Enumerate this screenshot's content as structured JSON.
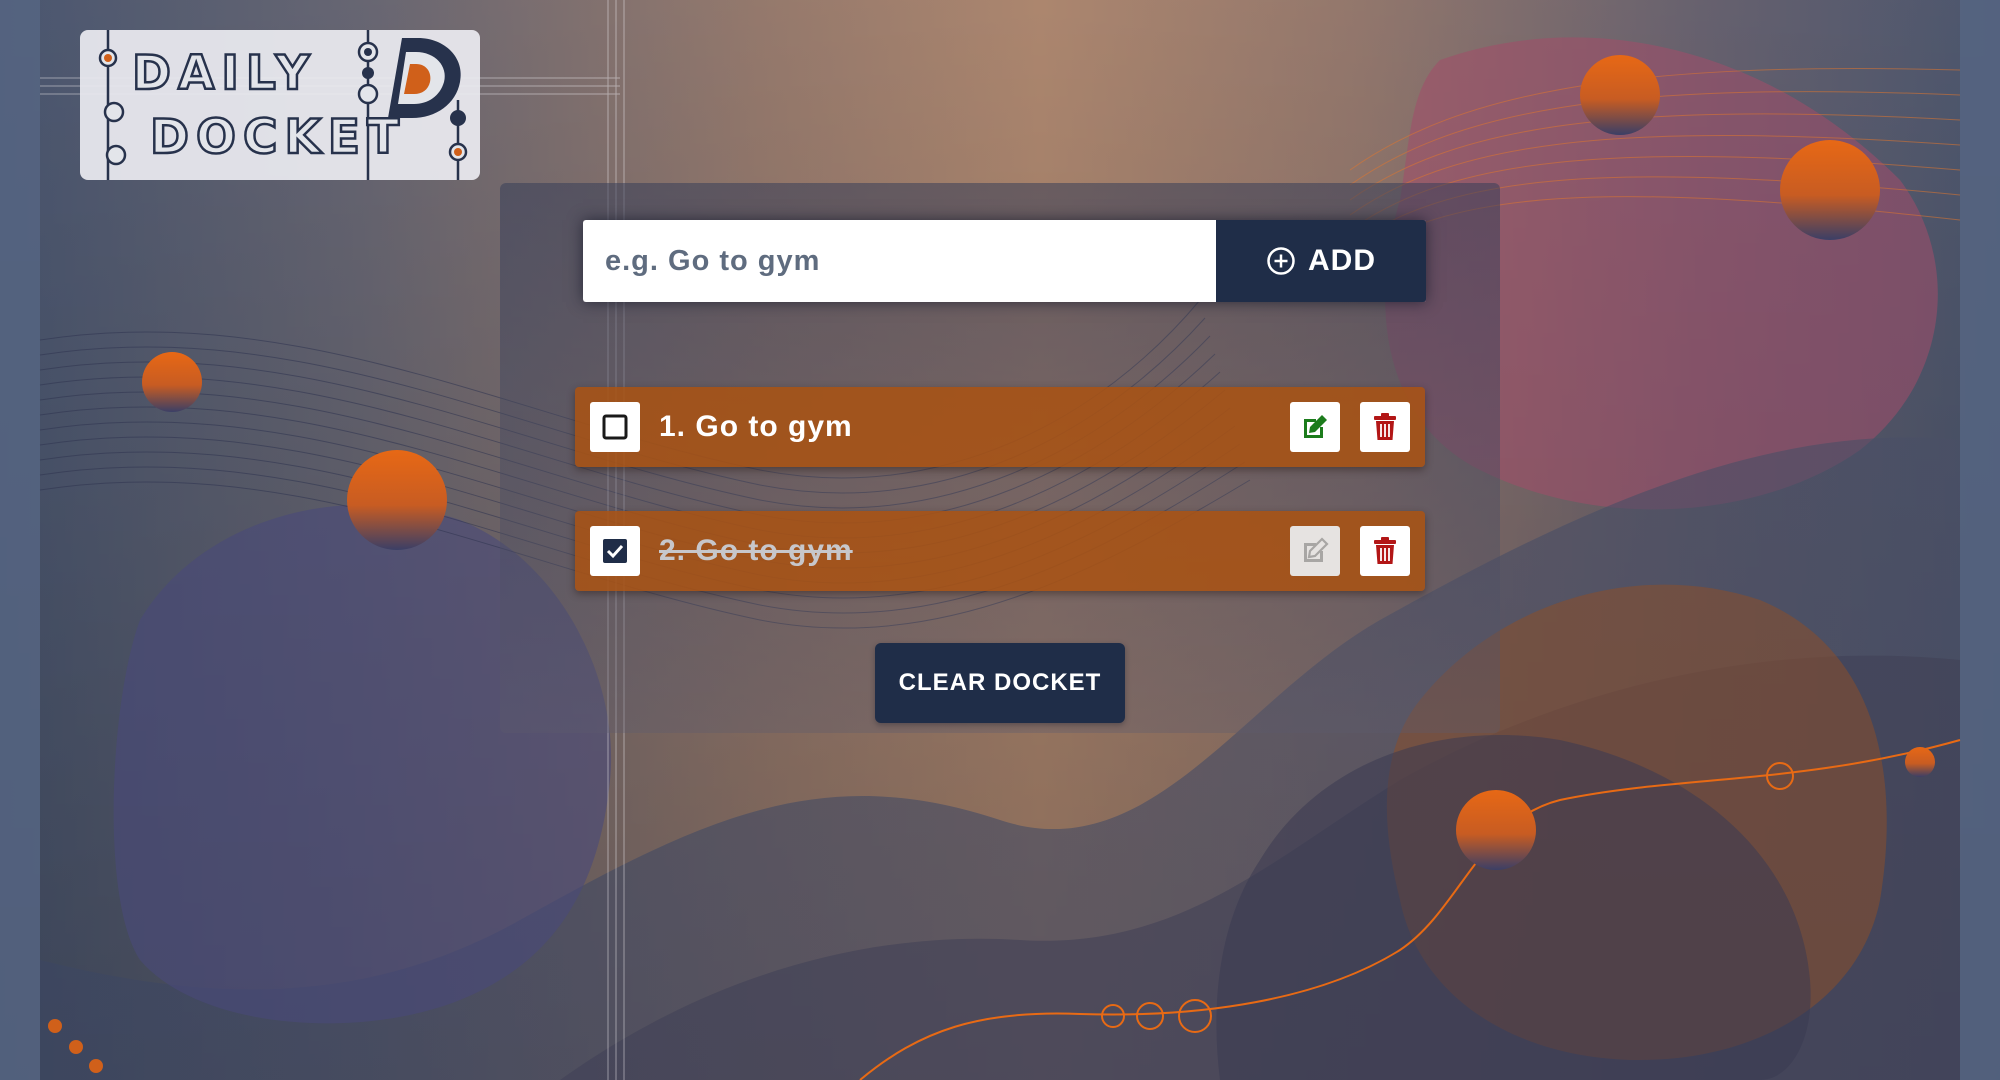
{
  "app": {
    "logo_line_1": "DAILY",
    "logo_line_2": "DOCKET",
    "logo_monogram": "D"
  },
  "add_form": {
    "placeholder": "e.g. Go to gym",
    "value": "",
    "add_label": "ADD",
    "add_icon": "plus-circle-icon"
  },
  "tasks": [
    {
      "label": "1. Go to gym",
      "completed": false,
      "edit_icon": "edit-icon",
      "delete_icon": "trash-icon"
    },
    {
      "label": "2. Go to gym",
      "completed": true,
      "edit_icon": "edit-icon",
      "delete_icon": "trash-icon"
    }
  ],
  "clear_label": "CLEAR DOCKET",
  "colors": {
    "accent": "#e86a14",
    "navy": "#1f2d48",
    "task_background": "#aa5212",
    "edit_green": "#1c7c1c",
    "delete_red": "#b21616"
  }
}
